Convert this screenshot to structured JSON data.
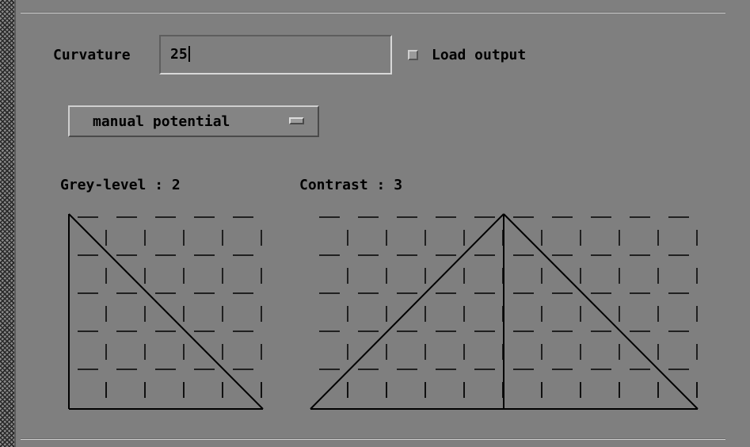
{
  "form": {
    "curvature": {
      "label": "Curvature",
      "value": "25"
    },
    "load_output": {
      "label": "Load output",
      "checked": true
    },
    "mode_select": {
      "value": "manual potential"
    }
  },
  "graphs": {
    "grey_level": {
      "label": "Grey-level : 2"
    },
    "contrast": {
      "label": "Contrast : 3"
    }
  },
  "colors": {
    "background": "#7f7f7f",
    "text": "#000000"
  }
}
